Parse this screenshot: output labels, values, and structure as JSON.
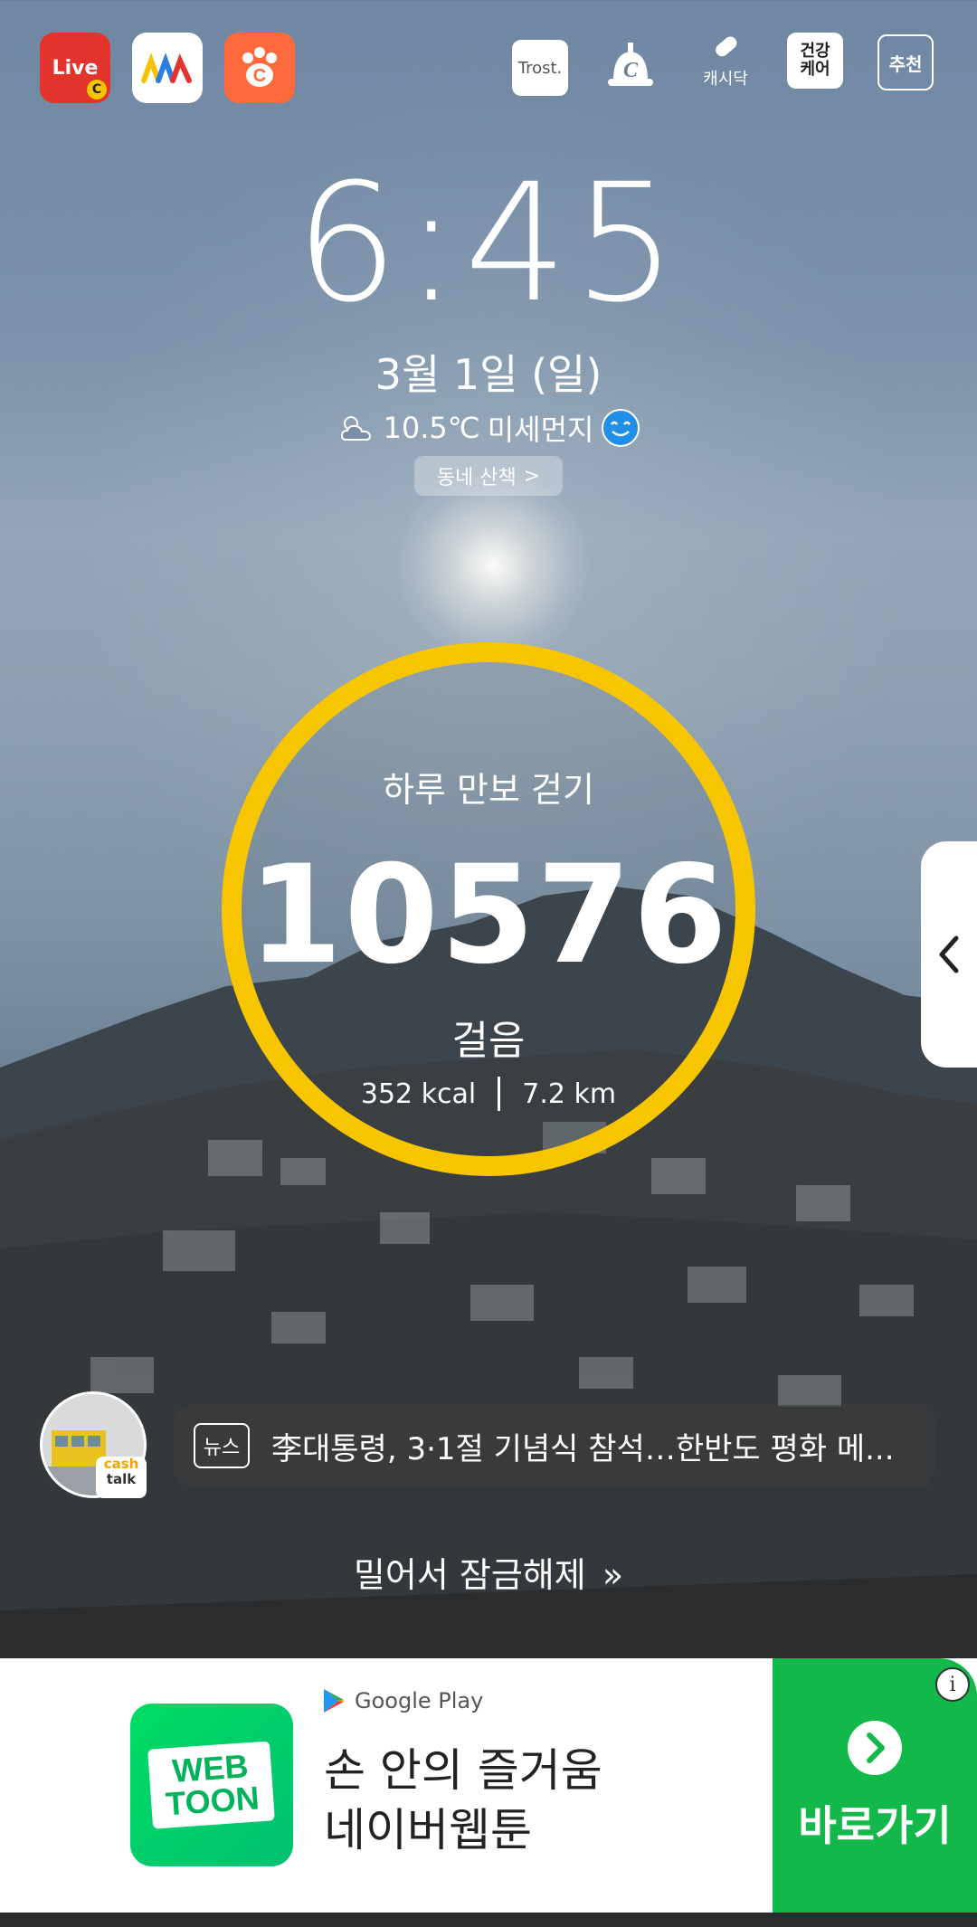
{
  "top_apps": [
    {
      "label": "Live",
      "badge": "C",
      "color": "#e2342d"
    },
    {
      "label": "",
      "color": "#ffffff"
    },
    {
      "label": "C",
      "color": "#ff6a3d"
    }
  ],
  "top_right": {
    "trost": "Trost.",
    "cash_doc": "캐시닥",
    "health_care_line1": "건강",
    "health_care_line2": "케어",
    "recommend": "추천"
  },
  "clock": {
    "time": "6:45"
  },
  "date": {
    "text": "3월 1일 (일)"
  },
  "weather": {
    "temperature": "10.5℃",
    "dust": "미세먼지"
  },
  "walk_button": {
    "label": "동네 산책"
  },
  "pedometer": {
    "title": "하루 만보 걷기",
    "steps": "10576",
    "unit": "걸음",
    "kcal": "352 kcal",
    "distance": "7.2 km",
    "ring_color": "#f7c600"
  },
  "news": {
    "tag": "뉴스",
    "headline": "李대통령, 3·1절 기념식 참석…한반도 평화 메...",
    "badge_line1": "cash",
    "badge_line2": "talk"
  },
  "unlock": {
    "label": "밀어서 잠금해제"
  },
  "ad": {
    "store": "Google Play",
    "line1": "손 안의 즐거움",
    "line2": "네이버웹툰",
    "logo_line1": "WEB",
    "logo_line2": "TOON",
    "cta": "바로가기",
    "info": "i",
    "cta_color": "#12b84a"
  }
}
